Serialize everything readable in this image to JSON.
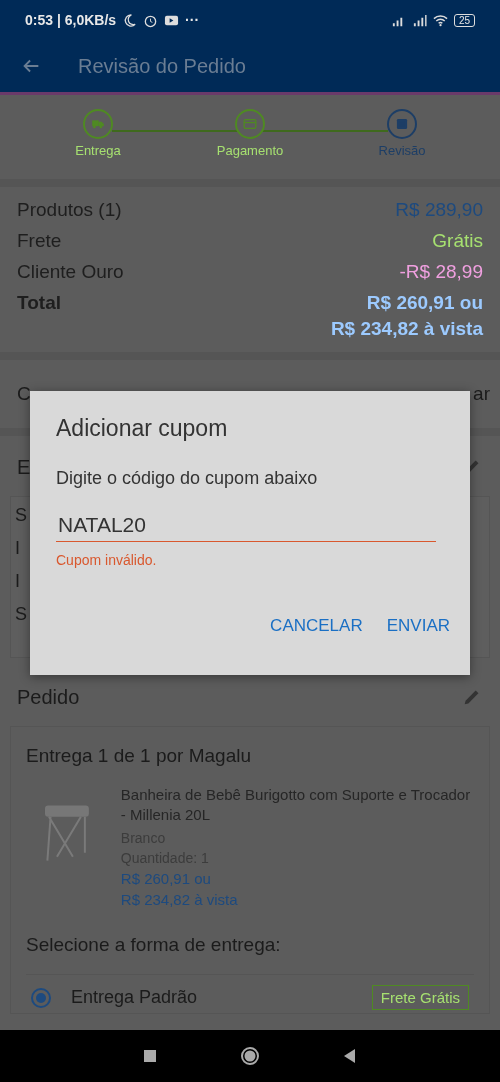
{
  "status_bar": {
    "time": "0:53 | 6,0KB/s",
    "more": "···",
    "battery": "25"
  },
  "header": {
    "title": "Revisão do Pedido"
  },
  "steps": [
    {
      "label": "Entrega",
      "selected": false
    },
    {
      "label": "Pagamento",
      "selected": false
    },
    {
      "label": "Revisão",
      "selected": true
    }
  ],
  "summary": [
    {
      "label": "Produtos (1)",
      "value": "R$ 289,90",
      "kind": "price"
    },
    {
      "label": "Frete",
      "value": "Grátis",
      "kind": "free"
    },
    {
      "label": "Cliente Ouro",
      "value": "-R$ 28,99",
      "kind": "discount"
    },
    {
      "label": "Total",
      "value": "R$ 260,91 ou",
      "value_2": "R$ 234,82 à vista",
      "kind": "total"
    }
  ],
  "coupon_row": {
    "left": "C",
    "right": "ar"
  },
  "address_section": {
    "title": "E",
    "lines": [
      "S",
      "I",
      "I",
      "S"
    ]
  },
  "order": {
    "title": "Pedido",
    "delivery_title": "Entrega 1 de 1 por Magalu",
    "product": {
      "name": "Banheira de Bebê Burigotto com Suporte e Trocador - Millenia 20L",
      "variant": "Branco",
      "quantity": "Quantidade:  1",
      "price": "R$ 260,91 ou",
      "price_cash": "R$ 234,82 à vista"
    },
    "shipping_prompt": "Selecione a forma de entrega:",
    "shipping_options": [
      {
        "label": "Entrega Padrão",
        "badge": "Frete Grátis",
        "selected": true
      }
    ]
  },
  "dialog": {
    "title": "Adicionar cupom",
    "message": "Digite o código do cupom abaixo",
    "input_value": "NATAL20",
    "error": "Cupom inválido.",
    "buttons": [
      "CANCELAR",
      "ENVIAR"
    ]
  }
}
